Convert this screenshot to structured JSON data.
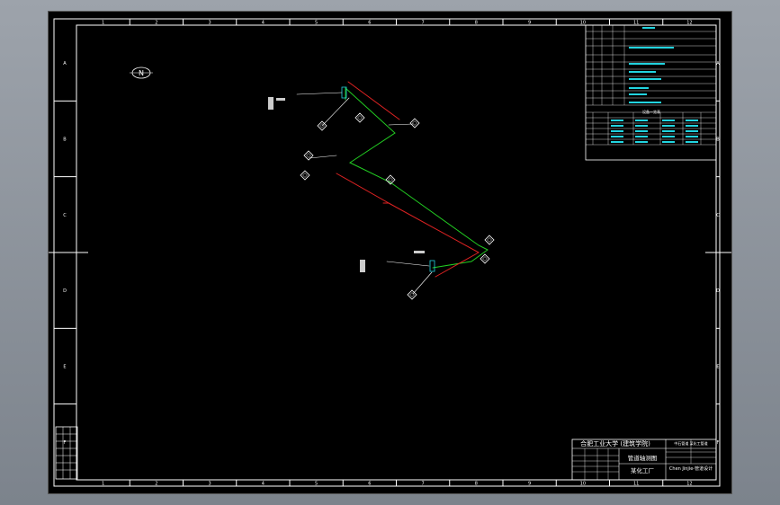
{
  "colors": {
    "background": "#000000",
    "border": "#ffffff",
    "pipe_green": "#22cc22",
    "slope_red": "#dd2222",
    "table_cyan": "#22d4e0",
    "text_white": "#ffffff"
  },
  "frame": {
    "col_labels": [
      "1",
      "2",
      "3",
      "4",
      "5",
      "6",
      "7",
      "8",
      "9",
      "10",
      "11",
      "12"
    ],
    "row_labels": [
      "A",
      "B",
      "C",
      "D",
      "E",
      "F"
    ]
  },
  "north_arrow": {
    "label": "N"
  },
  "title_block": {
    "school": "合肥工业大学 (建筑学院)",
    "drawing_name_1": "管道轴测图",
    "drawing_name_2": "某化工厂",
    "right_top": "中石管道 某化工管道",
    "right_mid": "Chen Jinjie-管道设计"
  },
  "equipment_table": {
    "title": "设备一览表"
  }
}
